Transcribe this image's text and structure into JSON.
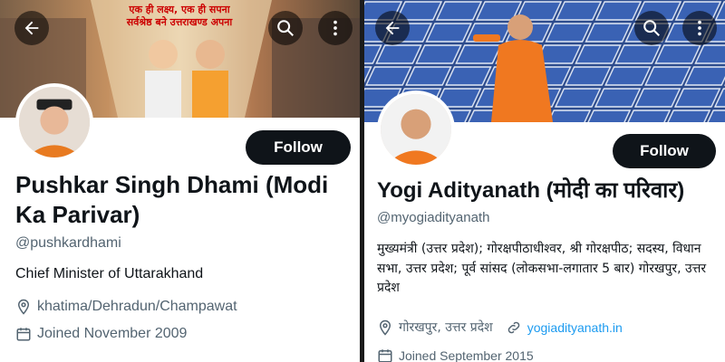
{
  "left_profile": {
    "banner": {
      "text_line1": "एक ही लक्ष्य, एक ही सपना",
      "text_line2": "सर्वश्रेष्ठ बने उत्तराखण्ड अपना"
    },
    "name": "Pushkar Singh Dhami (Modi Ka Parivar)",
    "handle": "@pushkardhami",
    "follow_label": "Follow",
    "bio": "Chief Minister of Uttarakhand",
    "location": "khatima/Dehradun/Champawat",
    "joined": "Joined November 2009",
    "icons": {
      "back": "back-arrow-icon",
      "search": "search-icon",
      "more": "more-vertical-icon",
      "location": "location-pin-icon",
      "calendar": "calendar-icon"
    }
  },
  "right_profile": {
    "name": "Yogi Adityanath (मोदी का परिवार)",
    "handle": "@myogiadityanath",
    "follow_label": "Follow",
    "bio": "मुख्यमंत्री (उत्तर प्रदेश); गोरक्षपीठाधीश्वर, श्री गोरक्षपीठ; सदस्य, विधान सभा, उत्तर प्रदेश; पूर्व सांसद (लोकसभा-लगातार 5 बार) गोरखपुर, उत्तर प्रदेश",
    "location": "गोरखपुर, उत्तर प्रदेश",
    "website": "yogiadityanath.in",
    "joined": "Joined September 2015",
    "icons": {
      "back": "back-arrow-icon",
      "search": "search-icon",
      "more": "more-vertical-icon",
      "location": "location-pin-icon",
      "link": "link-icon",
      "calendar": "calendar-icon"
    }
  },
  "colors": {
    "follow_bg": "#0f1419",
    "secondary_text": "#536471",
    "link": "#1d9bf0"
  }
}
